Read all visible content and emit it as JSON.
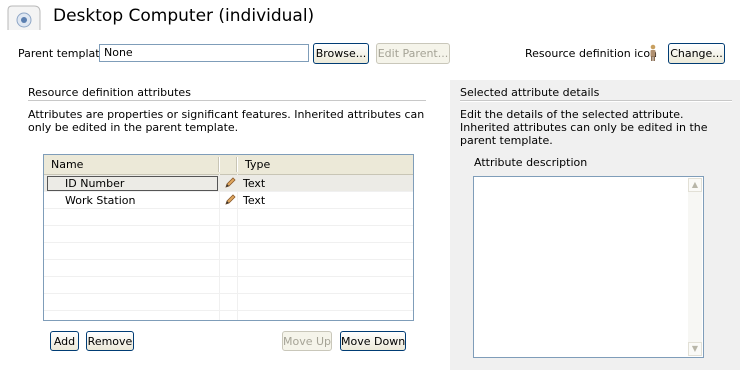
{
  "header": {
    "title": "Desktop Computer (individual)",
    "icon": "resource-template-icon"
  },
  "parent_template": {
    "label": "Parent template",
    "value": "None",
    "browse_label": "Browse...",
    "edit_parent_label": "Edit Parent..."
  },
  "resource_icon": {
    "label": "Resource definition icon",
    "icon": "person-icon",
    "change_label": "Change..."
  },
  "attributes_section": {
    "title": "Resource definition attributes",
    "description": "Attributes are properties or significant features. Inherited attributes can only be edited in the parent template.",
    "columns": [
      "Name",
      "Type"
    ],
    "rows": [
      {
        "name": "ID Number",
        "type": "Text",
        "icon": "pencil-icon",
        "selected": true
      },
      {
        "name": "Work Station",
        "type": "Text",
        "icon": "pencil-icon",
        "selected": false
      }
    ],
    "buttons": {
      "add": "Add",
      "remove": "Remove",
      "move_up": "Move Up",
      "move_down": "Move Down"
    }
  },
  "details_section": {
    "title": "Selected attribute details",
    "description": "Edit the details of the selected attribute. Inherited attributes can only be edited in the parent template.",
    "field_label": "Attribute description",
    "field_value": ""
  },
  "colors": {
    "panel_bg": "#f0f0f0",
    "input_border": "#7f9db9",
    "button_border": "#003c74",
    "disabled_text": "#a5a396"
  }
}
